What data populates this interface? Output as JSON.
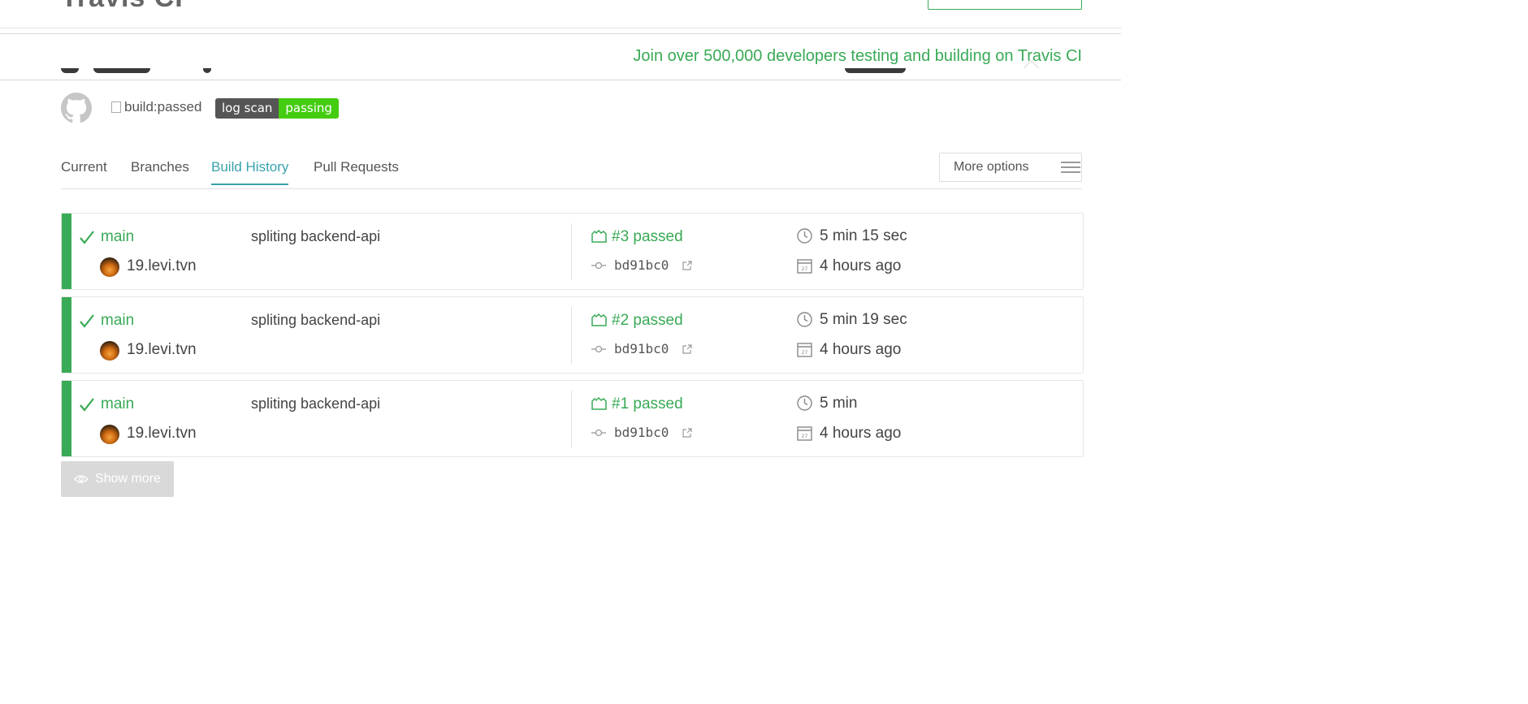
{
  "header": {
    "logo_fragment": "Travis CI"
  },
  "banner": {
    "text": "Join over 500,000 developers testing and building on Travis CI"
  },
  "repo": {
    "build_badge_alt": "build:passed",
    "scan_badge": {
      "label": "log scan",
      "status": "passing",
      "label_color": "#555555",
      "status_color": "#44cc11"
    }
  },
  "tabs": [
    {
      "label": "Current",
      "active": false
    },
    {
      "label": "Branches",
      "active": false
    },
    {
      "label": "Build History",
      "active": true
    },
    {
      "label": "Pull Requests",
      "active": false
    }
  ],
  "more_options": {
    "label": "More options"
  },
  "builds": [
    {
      "branch": "main",
      "author": "19.levi.tvn",
      "message": "spliting backend-api",
      "build": "#3 passed",
      "commit": "bd91bc0",
      "duration": "5 min 15 sec",
      "finished": "4 hours ago",
      "status": "passed"
    },
    {
      "branch": "main",
      "author": "19.levi.tvn",
      "message": "spliting backend-api",
      "build": "#2 passed",
      "commit": "bd91bc0",
      "duration": "5 min 19 sec",
      "finished": "4 hours ago",
      "status": "passed"
    },
    {
      "branch": "main",
      "author": "19.levi.tvn",
      "message": "spliting backend-api",
      "build": "#1 passed",
      "commit": "bd91bc0",
      "duration": "5 min",
      "finished": "4 hours ago",
      "status": "passed"
    }
  ],
  "show_more": {
    "label": "Show more"
  },
  "colors": {
    "passed": "#39aa56",
    "active_tab": "#38a2ad"
  },
  "icons": [
    "github-icon",
    "check-icon",
    "build-icon",
    "commit-icon",
    "external-link-icon",
    "clock-icon",
    "calendar-icon",
    "eye-icon",
    "hamburger-icon"
  ]
}
